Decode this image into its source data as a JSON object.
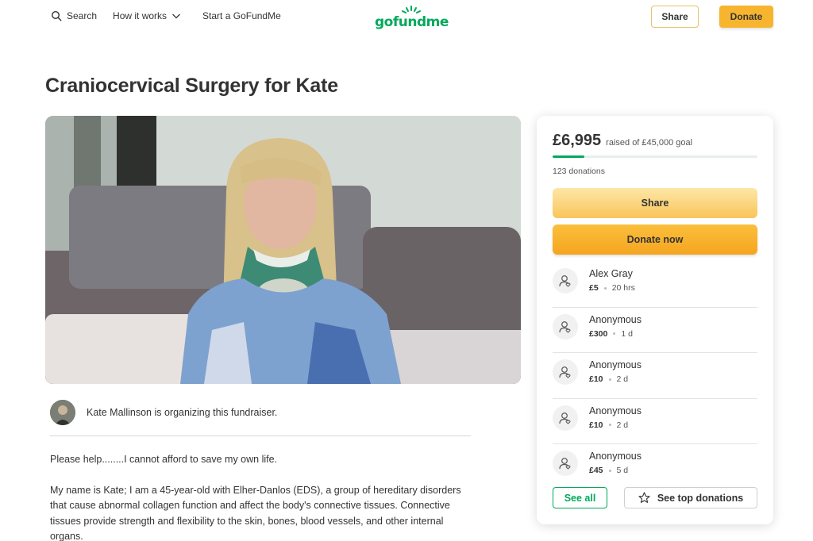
{
  "nav": {
    "search_label": "Search",
    "how_label": "How it works",
    "start_label": "Start a GoFundMe",
    "logo_text": "gofundme",
    "share_label": "Share",
    "donate_label": "Donate"
  },
  "campaign": {
    "title": "Craniocervical Surgery for Kate"
  },
  "organizer": {
    "text": "Kate Mallinson is organizing this fundraiser."
  },
  "story": {
    "p1": "Please help........I cannot afford to save my own life.",
    "p2": "My name is Kate; I am a 45-year-old with Elher-Danlos (EDS), a group of hereditary disorders that cause abnormal collagen function and affect the body's connective tissues. Connective tissues provide strength and flexibility to the skin, bones, blood vessels, and other internal organs."
  },
  "stats": {
    "raised": "£6,995",
    "goal_text": "raised of £45,000 goal",
    "progress_fraction": 0.155,
    "donations_count": "123 donations",
    "share_label": "Share",
    "donate_label": "Donate now"
  },
  "donations": [
    {
      "name": "Alex Gray",
      "amount": "£5",
      "time": "20 hrs"
    },
    {
      "name": "Anonymous",
      "amount": "£300",
      "time": "1 d"
    },
    {
      "name": "Anonymous",
      "amount": "£10",
      "time": "2 d"
    },
    {
      "name": "Anonymous",
      "amount": "£10",
      "time": "2 d"
    },
    {
      "name": "Anonymous",
      "amount": "£45",
      "time": "5 d"
    }
  ],
  "buttons": {
    "see_all": "See all",
    "see_top": "See top donations"
  },
  "colors": {
    "brand_green": "#02a95c",
    "donate_orange": "#f7b52f"
  }
}
